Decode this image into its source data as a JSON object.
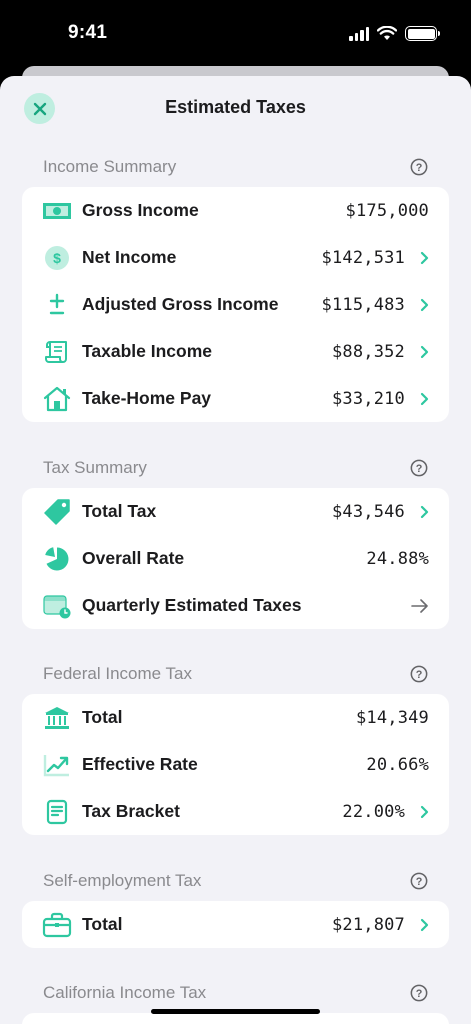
{
  "status_bar": {
    "time": "9:41"
  },
  "nav": {
    "title": "Estimated Taxes"
  },
  "colors": {
    "accent": "#2ec7a0",
    "secondary_text": "#8a8a8e",
    "background": "#f2f2f7"
  },
  "sections": [
    {
      "header": "Income Summary",
      "rows": [
        {
          "icon": "cash-icon",
          "label": "Gross Income",
          "value": "$175,000",
          "chevron": false
        },
        {
          "icon": "dollar-coin-icon",
          "label": "Net Income",
          "value": "$142,531",
          "chevron": true
        },
        {
          "icon": "plus-minus-icon",
          "label": "Adjusted Gross Income",
          "value": "$115,483",
          "chevron": true
        },
        {
          "icon": "scroll-icon",
          "label": "Taxable Income",
          "value": "$88,352",
          "chevron": true
        },
        {
          "icon": "house-icon",
          "label": "Take-Home Pay",
          "value": "$33,210",
          "chevron": true
        }
      ]
    },
    {
      "header": "Tax Summary",
      "rows": [
        {
          "icon": "tag-icon",
          "label": "Total Tax",
          "value": "$43,546",
          "chevron": true
        },
        {
          "icon": "pie-chart-icon",
          "label": "Overall Rate",
          "value": "24.88%",
          "chevron": false
        },
        {
          "icon": "calendar-clock-icon",
          "label": "Quarterly Estimated Taxes",
          "value": "",
          "chevron": false,
          "arrow": true
        }
      ]
    },
    {
      "header": "Federal Income Tax",
      "rows": [
        {
          "icon": "bank-icon",
          "label": "Total",
          "value": "$14,349",
          "chevron": false
        },
        {
          "icon": "trend-up-icon",
          "label": "Effective Rate",
          "value": "20.66%",
          "chevron": false
        },
        {
          "icon": "document-icon",
          "label": "Tax Bracket",
          "value": "22.00%",
          "chevron": true
        }
      ]
    },
    {
      "header": "Self-employment Tax",
      "rows": [
        {
          "icon": "briefcase-icon",
          "label": "Total",
          "value": "$21,807",
          "chevron": true
        }
      ]
    },
    {
      "header": "California Income Tax",
      "rows": []
    }
  ]
}
